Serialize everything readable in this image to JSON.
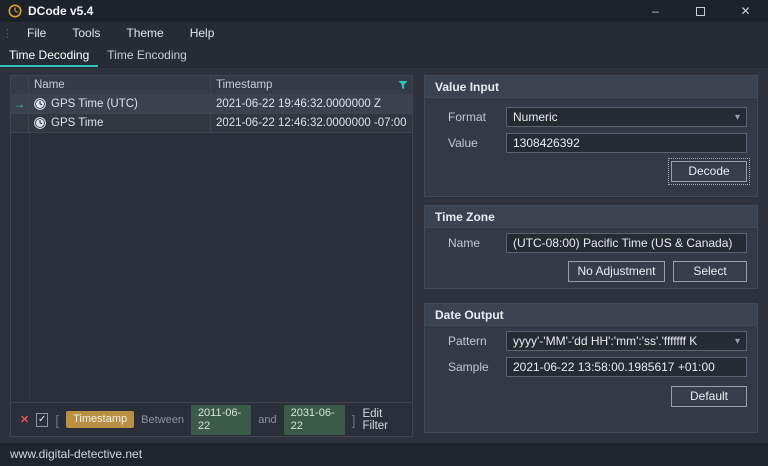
{
  "window": {
    "title": "DCode v5.4",
    "status_text": "www.digital-detective.net"
  },
  "icons": {
    "minimize": "–",
    "close": "✕",
    "grip": "⋮",
    "check": "✓",
    "remove": "✕",
    "arrow_right": "→",
    "caret_down": "▾"
  },
  "menu": {
    "items": [
      {
        "label": "File"
      },
      {
        "label": "Tools"
      },
      {
        "label": "Theme"
      },
      {
        "label": "Help"
      }
    ]
  },
  "tabs": [
    {
      "label": "Time Decoding",
      "active": true
    },
    {
      "label": "Time Encoding",
      "active": false
    }
  ],
  "results_table": {
    "columns": {
      "name": "Name",
      "timestamp": "Timestamp"
    },
    "rows": [
      {
        "name": "GPS Time (UTC)",
        "timestamp": "2021-06-22 19:46:32.0000000 Z",
        "selected": true
      },
      {
        "name": "GPS Time",
        "timestamp": "2021-06-22 12:46:32.0000000 -07:00",
        "selected": false
      }
    ]
  },
  "filter_bar": {
    "open_bracket": "[",
    "field": "Timestamp",
    "operator": "Between",
    "from": "2011-06-22",
    "conjunction": "and",
    "to": "2031-06-22",
    "close_bracket": "]",
    "edit_label": "Edit Filter"
  },
  "value_input": {
    "title": "Value Input",
    "format_label": "Format",
    "format_value": "Numeric",
    "value_label": "Value",
    "value": "1308426392",
    "decode_label": "Decode"
  },
  "time_zone": {
    "title": "Time Zone",
    "name_label": "Name",
    "name_value": "(UTC-08:00) Pacific Time (US & Canada)",
    "no_adjustment_label": "No Adjustment",
    "select_label": "Select"
  },
  "date_output": {
    "title": "Date Output",
    "pattern_label": "Pattern",
    "pattern_value": "yyyy'-'MM'-'dd HH':'mm':'ss'.'fffffff K",
    "sample_label": "Sample",
    "sample_value": "2021-06-22 13:58:00.1985617 +01:00",
    "default_label": "Default"
  },
  "colors": {
    "accent_teal": "#2cc5bb",
    "badge_amber": "#b98f44",
    "badge_green": "#3c5a49",
    "logo_gold": "#d9a62e",
    "remove_red": "#e0535a"
  }
}
